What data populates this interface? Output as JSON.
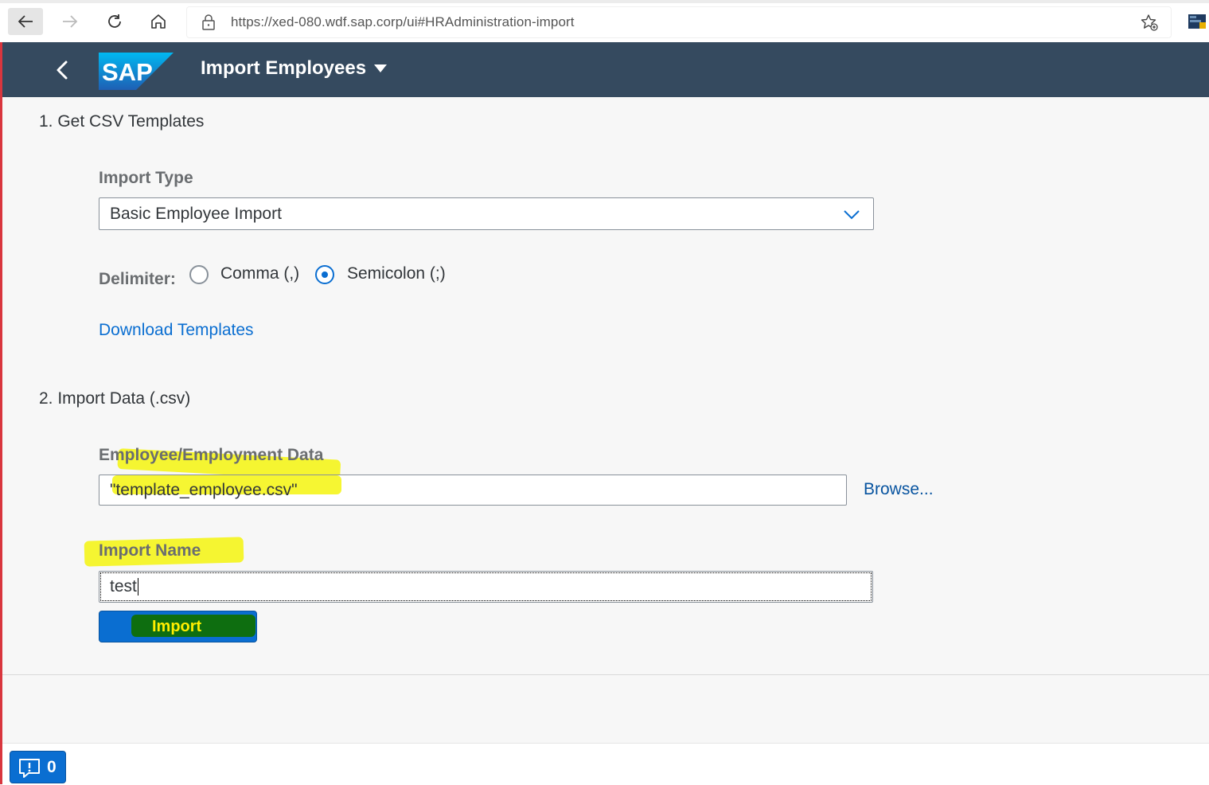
{
  "browser": {
    "url": "https://xed-080.wdf.sap.corp/ui#HRAdministration-import",
    "icons": [
      "back-arrow-icon",
      "forward-arrow-icon",
      "reload-icon",
      "home-icon",
      "lock-icon",
      "favorite-star-icon",
      "extension-icon"
    ]
  },
  "shell": {
    "logo_text": "SAP",
    "title": "Import Employees"
  },
  "section1": {
    "title": "1. Get CSV Templates",
    "import_type_label": "Import Type",
    "import_type_value": "Basic Employee Import",
    "delimiter_label": "Delimiter:",
    "delimiter_options": [
      "Comma (,)",
      "Semicolon (;)"
    ],
    "delimiter_selected": "Semicolon (;)",
    "download_link": "Download Templates"
  },
  "section2": {
    "title": "2. Import Data (.csv)",
    "file_label": "Employee/Employment Data",
    "file_value": "\"template_employee.csv\"",
    "browse_link": "Browse...",
    "import_name_label": "Import Name",
    "import_name_value": "test",
    "import_button": "Import"
  },
  "footer": {
    "message_count": "0"
  },
  "colors": {
    "shell_bg": "#354a5f",
    "accent": "#0a6ed1",
    "highlight_yellow": "#f4f50e",
    "highlight_green": "#0e6e10"
  }
}
